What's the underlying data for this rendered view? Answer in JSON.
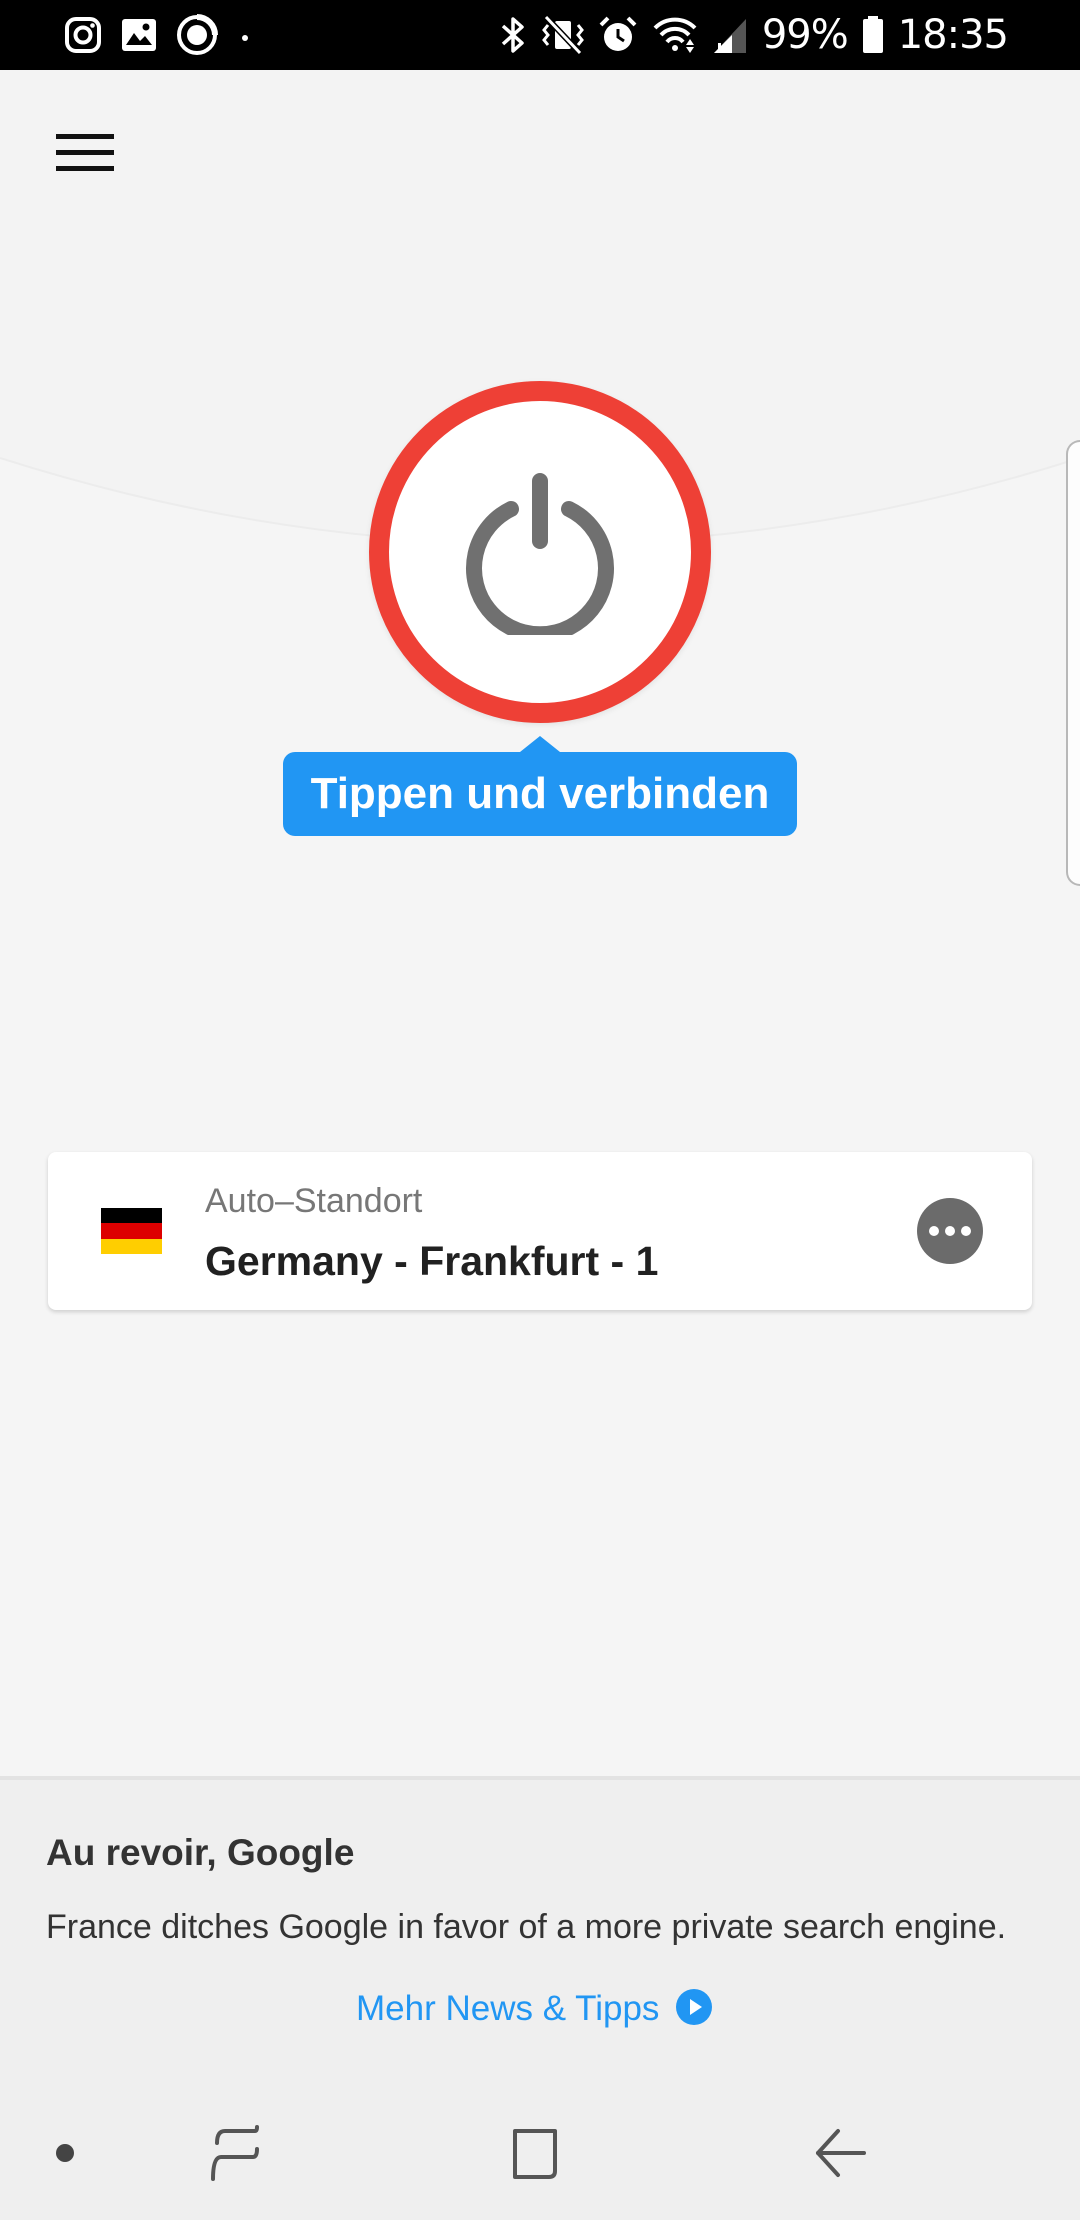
{
  "status_bar": {
    "left_icons": [
      "instagram-icon",
      "gallery-icon",
      "record-icon",
      "dot-icon"
    ],
    "right_icons": [
      "bluetooth-icon",
      "vibrate-icon",
      "alarm-icon",
      "wifi-icon",
      "signal-icon",
      "battery-icon"
    ],
    "battery_text": "99%",
    "clock_text": "18:35"
  },
  "header": {
    "menu_icon": "hamburger-menu-icon"
  },
  "connect": {
    "button_icon": "power-icon",
    "tooltip": "Tippen und verbinden"
  },
  "location": {
    "label": "Auto–Standort",
    "name": "Germany - Frankfurt - 1",
    "flag": "germany-flag",
    "more_icon": "more-options-icon"
  },
  "news": {
    "title": "Au revoir, Google",
    "body": "France ditches Google in favor of a more private search engine.",
    "link_text": "Mehr News & Tipps",
    "link_icon": "play-circle-icon"
  },
  "nav_bar": {
    "items": [
      "dot-icon",
      "recent-apps-icon",
      "home-icon",
      "back-icon"
    ]
  },
  "colors": {
    "power_ring": "#ee4036",
    "tooltip_bg": "#2196f3",
    "link": "#2196f3",
    "background": "#f5f5f5"
  }
}
